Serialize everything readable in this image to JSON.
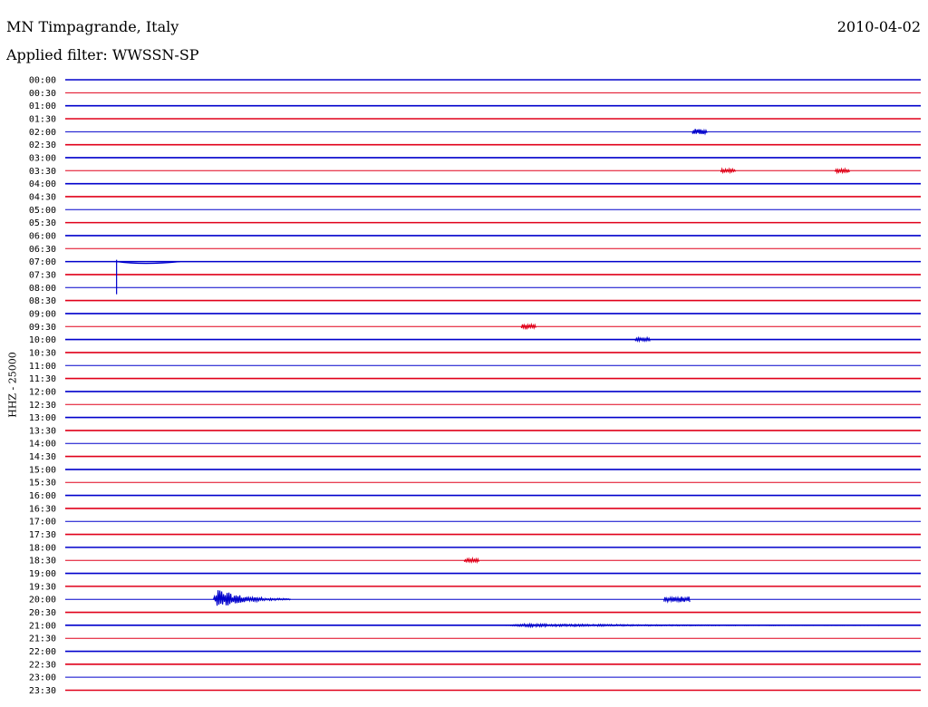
{
  "header": {
    "station": "MN Timpagrande, Italy",
    "filter": "Applied filter: WWSSN-SP",
    "date": "2010-04-02",
    "channel": "HHZ - 25000"
  },
  "chart_data": {
    "type": "line",
    "title": "MN Timpagrande, Italy",
    "subtitle": "Applied filter: WWSSN-SP",
    "ylabel": "HHZ - 25000",
    "grid": false,
    "colors": [
      "#0000cc",
      "#e0001a"
    ],
    "row_labels": [
      "00:00",
      "00:30",
      "01:00",
      "01:30",
      "02:00",
      "02:30",
      "03:00",
      "03:30",
      "04:00",
      "04:30",
      "05:00",
      "05:30",
      "06:00",
      "06:30",
      "07:00",
      "07:30",
      "08:00",
      "08:30",
      "09:00",
      "09:30",
      "10:00",
      "10:30",
      "11:00",
      "11:30",
      "12:00",
      "12:30",
      "13:00",
      "13:30",
      "14:00",
      "14:30",
      "15:00",
      "15:30",
      "16:00",
      "16:30",
      "17:00",
      "17:30",
      "18:00",
      "18:30",
      "19:00",
      "19:30",
      "20:00",
      "20:30",
      "21:00",
      "21:30",
      "22:00",
      "22:30",
      "23:00",
      "23:30"
    ],
    "events": [
      {
        "row": "02:00",
        "offset_min": 22,
        "amplitude": 3
      },
      {
        "row": "03:30",
        "offset_min": 23,
        "amplitude": 2
      },
      {
        "row": "03:30",
        "offset_min": 27,
        "amplitude": 2
      },
      {
        "row": "07:00",
        "offset_min": 1.8,
        "amplitude": 18,
        "type": "step"
      },
      {
        "row": "09:30",
        "offset_min": 16,
        "amplitude": 3
      },
      {
        "row": "10:00",
        "offset_min": 20,
        "amplitude": 2
      },
      {
        "row": "18:30",
        "offset_min": 14,
        "amplitude": 2
      },
      {
        "row": "20:00",
        "offset_min": 5.2,
        "amplitude": 14,
        "duration_min": 2.7
      },
      {
        "row": "20:00",
        "offset_min": 21,
        "amplitude": 3,
        "duration_min": 0.9
      },
      {
        "row": "21:00",
        "offset_min": 15.5,
        "amplitude": 2,
        "duration_min": 14
      }
    ]
  }
}
